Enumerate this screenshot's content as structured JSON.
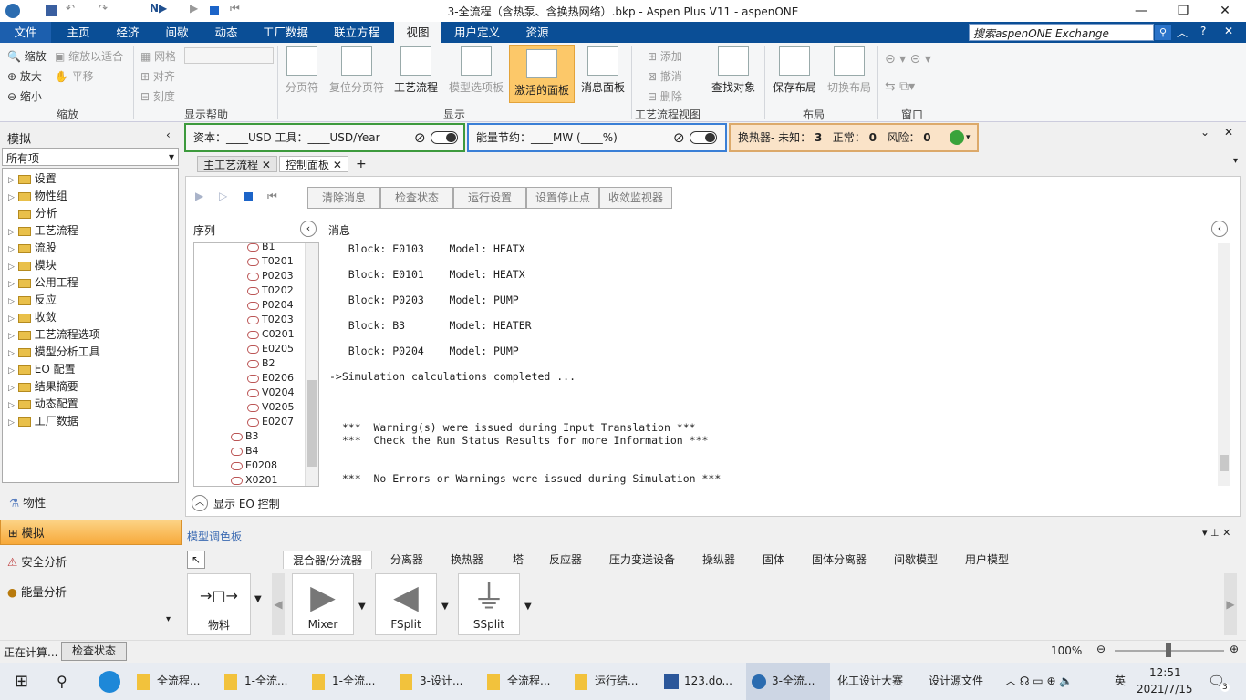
{
  "window": {
    "title": "3-全流程（含热泵、含换热网络）.bkp - Aspen Plus V11 - aspenONE"
  },
  "ribbon_tabs": [
    "文件",
    "主页",
    "经济",
    "间歇",
    "动态",
    "工厂数据",
    "联立方程",
    "视图",
    "用户定义",
    "资源"
  ],
  "search": {
    "placeholder": "搜索aspenONE Exchange"
  },
  "ribbon": {
    "zoom": {
      "label": "缩放",
      "zoom_fit": "缩放以适合",
      "zoom": "缩放",
      "zoom_in": "放大",
      "pan": "平移",
      "zoom_out": "缩小"
    },
    "display_help": {
      "label": "显示帮助",
      "grid": "网格",
      "align": "对齐",
      "scale": "刻度"
    },
    "display": {
      "label": "显示",
      "stream_id": "分页符",
      "reset": "复位分页符",
      "flowsheet": "工艺流程",
      "model_palette": "模型选项板",
      "control_panel": "激活的面板",
      "msg_panel": "消息面板"
    },
    "flowsheet_view": {
      "label": "工艺流程视图",
      "add": "添加",
      "cancel": "撤消",
      "delete": "删除",
      "find": "查找对象"
    },
    "layout": {
      "label": "布局",
      "save": "保存布局",
      "switch": "切换布局"
    },
    "window": {
      "label": "窗口"
    }
  },
  "left": {
    "header": "模拟",
    "filter": "所有项",
    "tree": [
      "设置",
      "物性组",
      "分析",
      "工艺流程",
      "流股",
      "模块",
      "公用工程",
      "反应",
      "收敛",
      "工艺流程选项",
      "模型分析工具",
      "EO 配置",
      "结果摘要",
      "动态配置",
      "工厂数据"
    ],
    "nav": {
      "props": "物性",
      "sim": "模拟",
      "safety": "安全分析",
      "energy": "能量分析"
    }
  },
  "bars": {
    "capital": "资本：____USD   工具：____USD/Year",
    "energy": "能量节约：____MW   (____%)",
    "hx_label": "换热器- 未知：",
    "hx_unknown": "3",
    "hx_ok_label": "正常：",
    "hx_ok": "0",
    "hx_risk_label": "风险：",
    "hx_risk": "0"
  },
  "doctabs": {
    "main": "主工艺流程",
    "ctrl": "控制面板"
  },
  "control": {
    "buttons": [
      "清除消息",
      "检查状态",
      "运行设置",
      "设置停止点",
      "收敛监视器"
    ],
    "seq_label": "序列",
    "msg_label": "消息",
    "seq": [
      "B1",
      "T0201",
      "P0203",
      "T0202",
      "P0204",
      "T0203",
      "C0201",
      "E0205",
      "B2",
      "E0206",
      "V0204",
      "V0205",
      "E0207",
      "B3",
      "B4",
      "E0208",
      "X0201"
    ],
    "messages": [
      "   Block: E0103    Model: HEATX",
      "   Block: E0101    Model: HEATX",
      "   Block: P0203    Model: PUMP",
      "   Block: B3       Model: HEATER",
      "   Block: P0204    Model: PUMP",
      "->Simulation calculations completed ...",
      "  ***  Warning(s) were issued during Input Translation ***",
      "  ***  Check the Run Status Results for more Information ***",
      "  ***  No Errors or Warnings were issued during Simulation ***"
    ],
    "eo": "显示 EO 控制"
  },
  "palette": {
    "title": "模型调色板",
    "tabs": [
      "混合器/分流器",
      "分离器",
      "换热器",
      "塔",
      "反应器",
      "压力变送设备",
      "操纵器",
      "固体",
      "固体分离器",
      "间歇模型",
      "用户模型"
    ],
    "items": [
      "物料",
      "Mixer",
      "FSplit",
      "SSplit"
    ]
  },
  "status": {
    "text": "正在计算...",
    "check": "检查状态",
    "zoom": "100%"
  },
  "taskbar": {
    "items": [
      "全流程...",
      "1-全流...",
      "1-全流...",
      "3-设计...",
      "全流程...",
      "运行结...",
      "123.do...",
      "3-全流..."
    ],
    "extra1": "化工设计大赛",
    "extra2": "设计源文件",
    "ime": "英",
    "time": "12:51",
    "date": "2021/7/15",
    "notif": "3"
  }
}
